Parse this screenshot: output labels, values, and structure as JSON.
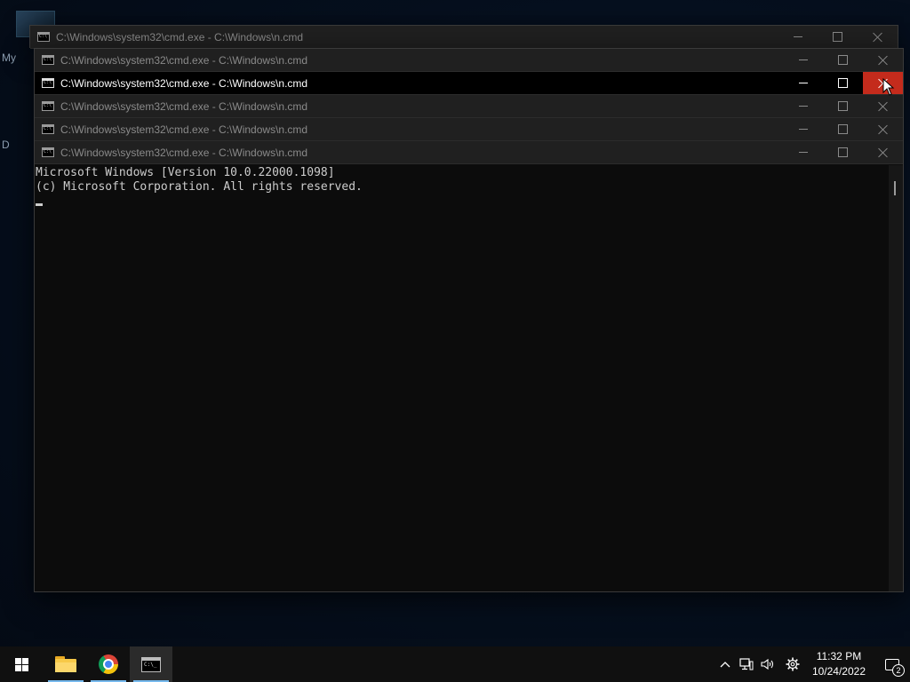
{
  "desktop": {
    "icon_labels": [
      "My",
      "D"
    ]
  },
  "windows": {
    "title": "C:\\Windows\\system32\\cmd.exe - C:\\Windows\\n.cmd",
    "titlebars": [
      {
        "title": "C:\\Windows\\system32\\cmd.exe - C:\\Windows\\n.cmd",
        "active": false
      },
      {
        "title": "C:\\Windows\\system32\\cmd.exe - C:\\Windows\\n.cmd",
        "active": false
      },
      {
        "title": "C:\\Windows\\system32\\cmd.exe - C:\\Windows\\n.cmd",
        "active": true
      },
      {
        "title": "C:\\Windows\\system32\\cmd.exe - C:\\Windows\\n.cmd",
        "active": false
      },
      {
        "title": "C:\\Windows\\system32\\cmd.exe - C:\\Windows\\n.cmd",
        "active": false
      },
      {
        "title": "C:\\Windows\\system32\\cmd.exe - C:\\Windows\\n.cmd",
        "active": false
      }
    ]
  },
  "console": {
    "lines": [
      "Microsoft Windows [Version 10.0.22000.1098]",
      "(c) Microsoft Corporation. All rights reserved."
    ]
  },
  "taskbar": {
    "apps": [
      {
        "name": "start",
        "icon": "windows-logo-icon"
      },
      {
        "name": "file-explorer",
        "icon": "folder-icon"
      },
      {
        "name": "chrome",
        "icon": "chrome-icon"
      },
      {
        "name": "command-prompt",
        "icon": "cmd-icon"
      }
    ],
    "clock": {
      "time": "11:32 PM",
      "date": "10/24/2022"
    },
    "notification_count": "2"
  },
  "colors": {
    "close_hover": "#c42b1c",
    "console_bg": "#0c0c0c",
    "console_text": "#cccccc",
    "taskbar_accent": "#76b9ed"
  }
}
